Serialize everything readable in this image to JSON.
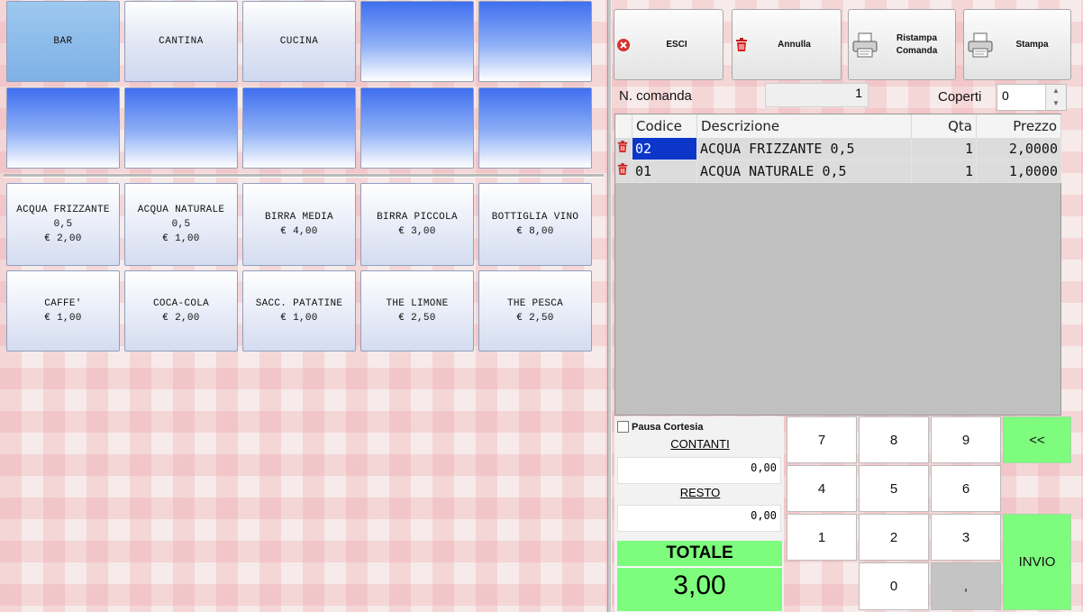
{
  "categories": {
    "row1": [
      "BAR",
      "CANTINA",
      "CUCINA",
      "",
      ""
    ],
    "row2": [
      "",
      "",
      "",
      "",
      ""
    ]
  },
  "products": [
    {
      "line1": "ACQUA FRIZZANTE",
      "line2": "0,5",
      "price": "€ 2,00"
    },
    {
      "line1": "ACQUA NATURALE",
      "line2": "0,5",
      "price": "€ 1,00"
    },
    {
      "line1": "BIRRA MEDIA",
      "line2": "",
      "price": "€ 4,00"
    },
    {
      "line1": "BIRRA PICCOLA",
      "line2": "",
      "price": "€ 3,00"
    },
    {
      "line1": "BOTTIGLIA VINO",
      "line2": "",
      "price": "€ 8,00"
    },
    {
      "line1": "CAFFE'",
      "line2": "",
      "price": "€ 1,00"
    },
    {
      "line1": "COCA-COLA",
      "line2": "",
      "price": "€ 2,00"
    },
    {
      "line1": "SACC. PATATINE",
      "line2": "",
      "price": "€ 1,00"
    },
    {
      "line1": "THE LIMONE",
      "line2": "",
      "price": "€ 2,50"
    },
    {
      "line1": "THE PESCA",
      "line2": "",
      "price": "€ 2,50"
    }
  ],
  "toolbar": {
    "esci": "ESCI",
    "annulla": "Annulla",
    "ristampa": "Ristampa Comanda",
    "stampa": "Stampa"
  },
  "order": {
    "n_comanda_label": "N. comanda",
    "n_comanda_value": "1",
    "coperti_label": "Coperti",
    "coperti_value": "0"
  },
  "table": {
    "headers": {
      "codice": "Codice",
      "descrizione": "Descrizione",
      "qta": "Qta",
      "prezzo": "Prezzo"
    },
    "rows": [
      {
        "codice": "02",
        "descrizione": "ACQUA FRIZZANTE 0,5",
        "qta": "1",
        "prezzo": "2,0000"
      },
      {
        "codice": "01",
        "descrizione": "ACQUA NATURALE 0,5",
        "qta": "1",
        "prezzo": "1,0000"
      }
    ]
  },
  "payment": {
    "pausa_label": "Pausa Cortesia",
    "contanti_label": "CONTANTI",
    "contanti_value": "0,00",
    "resto_label": "RESTO",
    "resto_value": "0,00",
    "totale_label": "TOTALE",
    "totale_value": "3,00"
  },
  "keypad": {
    "k7": "7",
    "k8": "8",
    "k9": "9",
    "back": "<<",
    "k4": "4",
    "k5": "5",
    "k6": "6",
    "k1": "1",
    "k2": "2",
    "k3": "3",
    "invio": "INVIO",
    "k0": "0",
    "comma": ","
  },
  "colors": {
    "accent_green": "#7dfc7d",
    "selection_blue": "#0b36c9",
    "category_blue": "#3f6ff0"
  },
  "icons": [
    "close-circle-icon",
    "trash-icon",
    "printer-icon"
  ]
}
